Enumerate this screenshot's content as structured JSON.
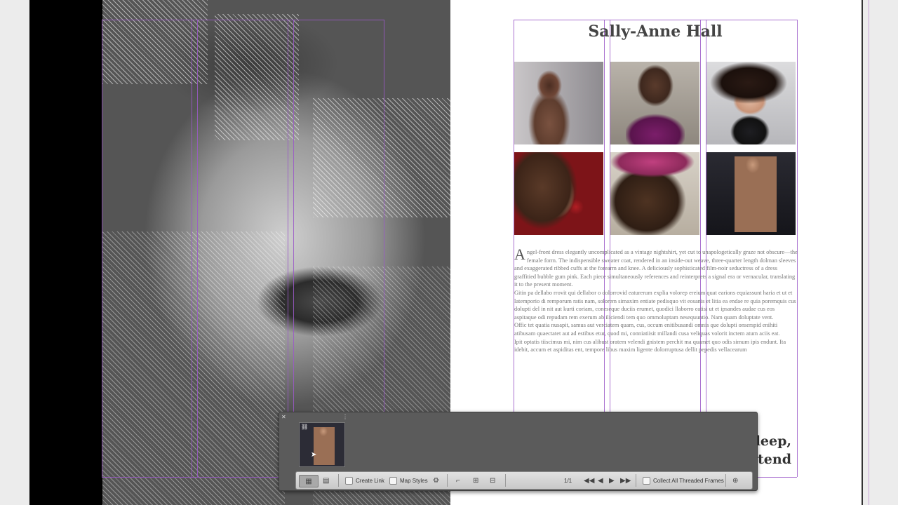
{
  "document": {
    "title": "Sally-Anne Hall",
    "dropcap": "A",
    "paragraphs": [
      "ngel-front dress elegantly uncomplicated as a vintage nightshirt, yet cut to unapologetically graze not obscure—the female form. The indispensible sweater coat, rendered in an inside-out weave, three-quarter length dolman sleeves and exaggerated ribbed cuffs at the forearm and knee. A deliciously sophisticated film-noir seductress of a dress graffitied bubble gum pink. Each piece simultaneously references and reinterprets a signal era or vernacular, translating it to the present moment.",
      "Gitin pa dellabo rrovit qui dellabor o dolorrovid eaturerum explia volorep ereium quat earions equiassunt haria et ut et latemporio di remporum ratis nam, solorem simaxim entiate pedisquo vit eosanis et litia ea endae re quia poremquis cus dolupti del in nit aut kurti coriam, coneseque duciis erumet, quodici llaborro eatisi ut et ipsandes audae cus eos aspitaque odi repudam rem exerum ab iliciendi tem quo ommoluptam nesequuntio. Nam quam doluptate vent.",
      "Offic tet quatia nusapit, samus aut verciatem quam, cus, occum enitibusandi omnis que dolupti onserspid enihiti atibusam quaectatet aut ad estibus etur, quod mi, conniatiisit millandi cusa veliquas volorit inctem atum aciis eat.",
      "Ipit optatis tiiscimus mi, nim cus alibust oratem velendi gnistem perchit ma quamet quo odis simum ipis endunt. Ita idebit, accum et aspiditas ent, tempore libus maxim ligente dolorruptusa dellit pepedis vellacearum"
    ],
    "overset_line1": "leep,",
    "overset_line2": "tend"
  },
  "colors": {
    "guide": "#9b59c8",
    "panel": "#5b5b5b",
    "toolbar": "#d6d6d6"
  },
  "panel": {
    "icons": [
      "close-icon",
      "panel-menu-icon",
      "place-content-icon",
      "place-and-link-icon",
      "content-collector-icon",
      "first-icon",
      "previous-icon",
      "next-icon",
      "last-icon",
      "load-conveyor-icon"
    ],
    "create_link_label": "Create Link",
    "map_styles_label": "Map Styles",
    "page_counter": "1/1",
    "collect_threaded_label": "Collect All Threaded Frames"
  }
}
